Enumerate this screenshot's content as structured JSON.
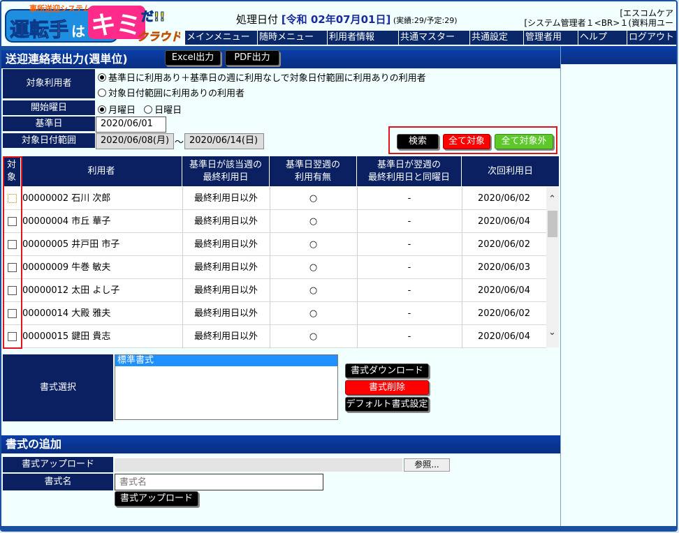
{
  "header": {
    "logo_small": "事所送迎システム",
    "logo_main1": "運転手",
    "logo_main2": "は",
    "logo_main3": "キミ",
    "logo_main4": "だ!!",
    "logo_cloud": "クラウド",
    "proc_label": "処理日付 ",
    "proc_date": "[令和 02年07月01日]",
    "proc_counts": " (実績:29/予定:29)",
    "company": "[エスコムケア",
    "user": "[システム管理者１<BR>１(資料用ユー"
  },
  "menu": [
    "メインメニュー",
    "随時メニュー",
    "利用者情報",
    "共通マスター",
    "共通設定",
    "管理者用",
    "ヘルプ",
    "ログアウト"
  ],
  "section1": {
    "title": "送迎連絡表出力(週単位)",
    "excel_btn": "Excel出力",
    "pdf_btn": "PDF出力"
  },
  "form": {
    "target_label": "対象利用者",
    "target_opt1": "基準日に利用あり＋基準日の週に利用なしで対象日付範囲に利用ありの利用者",
    "target_opt2": "対象日付範囲に利用ありの利用者",
    "weekday_label": "開始曜日",
    "weekday_opt1": "月曜日",
    "weekday_opt2": "日曜日",
    "base_label": "基準日",
    "base_value": "2020/06/01",
    "range_label": "対象日付範囲",
    "range_from": "2020/06/08(月)",
    "range_sep": "〜",
    "range_to": "2020/06/14(日)",
    "search_btn": "検索",
    "all_on_btn": "全て対象",
    "all_off_btn": "全て対象外"
  },
  "table": {
    "headers": [
      "対\n象",
      "利用者",
      "基準日が該当週の\n最終利用日",
      "基準日翌週の\n利用有無",
      "基準日が翌週の\n最終利用日と同曜日",
      "次回利用日"
    ],
    "rows": [
      [
        "00000002 石川 次郎",
        "最終利用日以外",
        "○",
        "-",
        "2020/06/02"
      ],
      [
        "00000004 市丘 華子",
        "最終利用日以外",
        "○",
        "-",
        "2020/06/04"
      ],
      [
        "00000005 井戸田 市子",
        "最終利用日以外",
        "○",
        "-",
        "2020/06/02"
      ],
      [
        "00000009 牛巻 敏夫",
        "最終利用日以外",
        "○",
        "-",
        "2020/06/03"
      ],
      [
        "00000012 太田 よし子",
        "最終利用日以外",
        "○",
        "-",
        "2020/06/04"
      ],
      [
        "00000014 大殿 雅夫",
        "最終利用日以外",
        "○",
        "-",
        "2020/06/02"
      ],
      [
        "00000015 鍵田 貴志",
        "最終利用日以外",
        "○",
        "-",
        "2020/06/04"
      ]
    ]
  },
  "format": {
    "label": "書式選択",
    "options": [
      "標準書式"
    ],
    "download_btn": "書式ダウンロード",
    "delete_btn": "書式削除",
    "default_btn": "デフォルト書式設定"
  },
  "section2": {
    "title": "書式の追加",
    "upload_label": "書式アップロード",
    "browse_btn": "参照...",
    "name_label": "書式名",
    "name_placeholder": "書式名",
    "upload_btn": "書式アップロード"
  },
  "colors": {
    "navy": "#0a2060",
    "accent": "#1a2a9a",
    "red": "#ff0000",
    "green": "#5cc82a"
  }
}
